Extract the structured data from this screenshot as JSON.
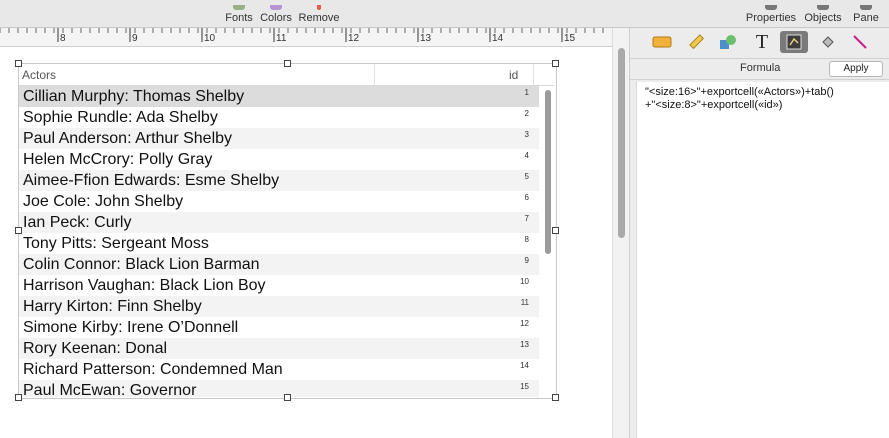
{
  "toolbar": {
    "fonts": "Fonts",
    "colors": "Colors",
    "remove": "Remove",
    "properties": "Properties",
    "objects": "Objects",
    "pane": "Pane"
  },
  "ruler": {
    "ticks": [
      "8",
      "9",
      "10",
      "11",
      "12",
      "13",
      "14",
      "15"
    ]
  },
  "table": {
    "col_actors": "Actors",
    "col_id": "id",
    "rows": [
      {
        "name": "Cillian Murphy: Thomas Shelby",
        "id": "1"
      },
      {
        "name": "Sophie Rundle: Ada Shelby",
        "id": "2"
      },
      {
        "name": "Paul Anderson: Arthur Shelby",
        "id": "3"
      },
      {
        "name": "Helen McCrory: Polly Gray",
        "id": "4"
      },
      {
        "name": "Aimee-Ffion Edwards: Esme Shelby",
        "id": "5"
      },
      {
        "name": "Joe Cole: John Shelby",
        "id": "6"
      },
      {
        "name": "Ian Peck: Curly",
        "id": "7"
      },
      {
        "name": "Tony Pitts: Sergeant Moss",
        "id": "8"
      },
      {
        "name": "Colin Connor: Black Lion Barman",
        "id": "9"
      },
      {
        "name": "Harrison Vaughan: Black Lion Boy",
        "id": "10"
      },
      {
        "name": "Harry Kirton: Finn Shelby",
        "id": "11"
      },
      {
        "name": "Simone Kirby: Irene O’Donnell",
        "id": "12"
      },
      {
        "name": "Rory Keenan: Donal",
        "id": "13"
      },
      {
        "name": "Richard Patterson: Condemned Man",
        "id": "14"
      },
      {
        "name": "Paul McEwan: Governor",
        "id": "15"
      }
    ]
  },
  "panel": {
    "title": "Formula",
    "apply": "Apply",
    "formula_line1": "\"<size:16>\"+exportcell(«Actors»)+tab()",
    "formula_line2": "+\"<size:8>\"+exportcell(«id»)",
    "tab_icons": [
      "tag-icon",
      "ruler-icon",
      "shapes-icon",
      "text-icon",
      "formula-icon",
      "fill-icon",
      "pen-icon"
    ]
  },
  "colors": {
    "selected_row": "#dcdcdc",
    "alt_row": "#f3f3f3",
    "active_tab": "#7a7a7a"
  }
}
